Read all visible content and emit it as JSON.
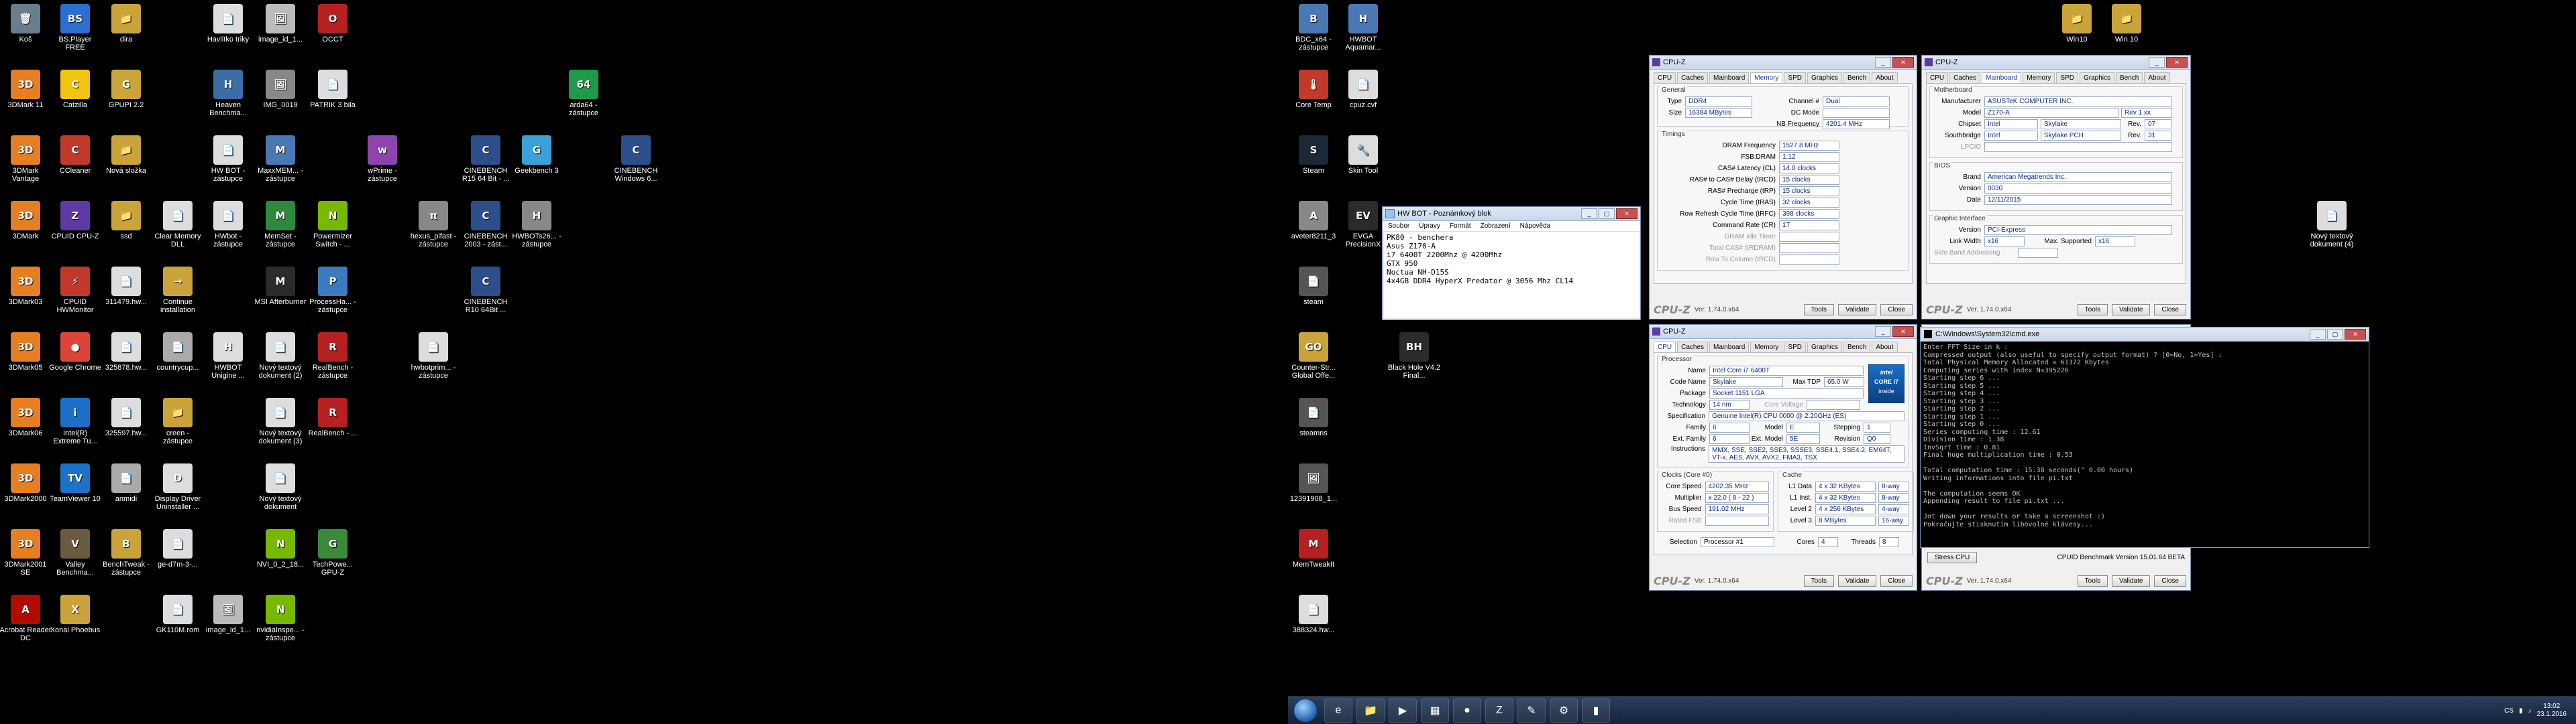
{
  "left_desktop_icons": [
    {
      "label": "Koš",
      "color": "#6a7d8c",
      "glyph": "🗑"
    },
    {
      "label": "BS.Player FREE",
      "color": "#2a6fd1",
      "glyph": "BS"
    },
    {
      "label": "dira",
      "color": "#caa43a",
      "glyph": "📁"
    },
    {
      "label": "Havlitko triky",
      "color": "#ddd",
      "glyph": "📄"
    },
    {
      "label": "image_id_1...",
      "color": "#bbb",
      "glyph": "🖼"
    },
    {
      "label": "OCCT",
      "color": "#b52020",
      "glyph": "O"
    },
    {
      "label": "3DMark 11",
      "color": "#e67e22",
      "glyph": "3D"
    },
    {
      "label": "Catzilla",
      "color": "#f1c40f",
      "glyph": "C"
    },
    {
      "label": "GPUPI 2.2",
      "color": "#c9a53a",
      "glyph": "G"
    },
    {
      "label": "Heaven Benchma...",
      "color": "#3a6ea5",
      "glyph": "H"
    },
    {
      "label": "IMG_0019",
      "color": "#888",
      "glyph": "🖼"
    },
    {
      "label": "PATRIK 3 bila",
      "color": "#ddd",
      "glyph": "📄"
    },
    {
      "label": "arda64 - zástupce",
      "color": "#1e9a4a",
      "glyph": "64"
    },
    {
      "label": "3DMark Vantage",
      "color": "#e67e22",
      "glyph": "3D"
    },
    {
      "label": "CCleaner",
      "color": "#c0392b",
      "glyph": "C"
    },
    {
      "label": "Nová složka",
      "color": "#caa43a",
      "glyph": "📁"
    },
    {
      "label": "HW BOT - zástupce",
      "color": "#ddd",
      "glyph": "📄"
    },
    {
      "label": "MaxxMEM... - zástupce",
      "color": "#4a78b5",
      "glyph": "M"
    },
    {
      "label": "wPrime - zástupce",
      "color": "#8e44ad",
      "glyph": "w"
    },
    {
      "label": "CINEBENCH R15 64 Bit - ...",
      "color": "#2c4f8c",
      "glyph": "C"
    },
    {
      "label": "Geekbench 3",
      "color": "#3aa0d8",
      "glyph": "G"
    },
    {
      "label": "CINEBENCH Windows 6...",
      "color": "#2c4f8c",
      "glyph": "C"
    },
    {
      "label": "3DMark",
      "color": "#e67e22",
      "glyph": "3D"
    },
    {
      "label": "CPUID CPU-Z",
      "color": "#5e3aa5",
      "glyph": "Z"
    },
    {
      "label": "ssd",
      "color": "#caa43a",
      "glyph": "📁"
    },
    {
      "label": "Clear Memory DLL",
      "color": "#ddd",
      "glyph": "📄"
    },
    {
      "label": "HWbot - zástupce",
      "color": "#ddd",
      "glyph": "📄"
    },
    {
      "label": "MemSet - zástupce",
      "color": "#2d8a3d",
      "glyph": "M"
    },
    {
      "label": "Powermizer Switch - ...",
      "color": "#76b900",
      "glyph": "N"
    },
    {
      "label": "hexus_pifast - zástupce",
      "color": "#888",
      "glyph": "π"
    },
    {
      "label": "CINEBENCH 2003 - zást...",
      "color": "#2c4f8c",
      "glyph": "C"
    },
    {
      "label": "HWBOTs26... - zástupce",
      "color": "#888",
      "glyph": "H"
    },
    {
      "label": "3DMark03",
      "color": "#e67e22",
      "glyph": "3D"
    },
    {
      "label": "CPUID HWMonitor",
      "color": "#c0392b",
      "glyph": "⚡"
    },
    {
      "label": "311479.hw...",
      "color": "#ddd",
      "glyph": "📄"
    },
    {
      "label": "Continue installation",
      "color": "#caa43a",
      "glyph": "→"
    },
    {
      "label": "MSI Afterburner",
      "color": "#2b2b2b",
      "glyph": "M"
    },
    {
      "label": "ProcessHa... - zástupce",
      "color": "#3b7bbf",
      "glyph": "P"
    },
    {
      "label": "CINEBENCH R10 64Bit ...",
      "color": "#2c4f8c",
      "glyph": "C"
    },
    {
      "label": "3DMark05",
      "color": "#e67e22",
      "glyph": "3D"
    },
    {
      "label": "Google Chrome",
      "color": "#db4437",
      "glyph": "●"
    },
    {
      "label": "325878.hw...",
      "color": "#ddd",
      "glyph": "📄"
    },
    {
      "label": "countrycup...",
      "color": "#aaa",
      "glyph": "📄"
    },
    {
      "label": "HWBOT Unigine ...",
      "color": "#ddd",
      "glyph": "H"
    },
    {
      "label": "Nový textový dokument (2)",
      "color": "#ddd",
      "glyph": "📄"
    },
    {
      "label": "RealBench - zástupce",
      "color": "#b52020",
      "glyph": "R"
    },
    {
      "label": "hwbotprim... - zástupce",
      "color": "#ddd",
      "glyph": "📄"
    },
    {
      "label": "3DMark06",
      "color": "#e67e22",
      "glyph": "3D"
    },
    {
      "label": "Intel(R) Extreme Tu...",
      "color": "#1c6fc4",
      "glyph": "i"
    },
    {
      "label": "325597.hw...",
      "color": "#ddd",
      "glyph": "📄"
    },
    {
      "label": "creen - zástupce",
      "color": "#caa43a",
      "glyph": "📁"
    },
    {
      "label": "Nový textový dokument (3)",
      "color": "#ddd",
      "glyph": "📄"
    },
    {
      "label": "RealBench - ...",
      "color": "#b52020",
      "glyph": "R"
    },
    {
      "label": "3DMark2000",
      "color": "#e67e22",
      "glyph": "3D"
    },
    {
      "label": "TeamViewer 10",
      "color": "#1a73c9",
      "glyph": "TV"
    },
    {
      "label": "anmidi",
      "color": "#aaa",
      "glyph": "📄"
    },
    {
      "label": "Display Driver Uninstaller ...",
      "color": "#ddd",
      "glyph": "D"
    },
    {
      "label": "Nový textový dokument",
      "color": "#ddd",
      "glyph": "📄"
    },
    {
      "label": "3DMark2001 SE",
      "color": "#e67e22",
      "glyph": "3D"
    },
    {
      "label": "Valley Benchma...",
      "color": "#6b5b3e",
      "glyph": "V"
    },
    {
      "label": "BenchTweak - zástupce",
      "color": "#caa43a",
      "glyph": "B"
    },
    {
      "label": "ge-d7m-3-...",
      "color": "#ddd",
      "glyph": "📄"
    },
    {
      "label": "NVI_0_2_18...",
      "color": "#76b900",
      "glyph": "N"
    },
    {
      "label": "TechPowe... GPU-Z",
      "color": "#3a8a3a",
      "glyph": "G"
    },
    {
      "label": "Acrobat Reader DC",
      "color": "#b30b00",
      "glyph": "A"
    },
    {
      "label": "Xonai Phoebus",
      "color": "#caa43a",
      "glyph": "X"
    },
    {
      "label": "GK110M.rom",
      "color": "#ddd",
      "glyph": "📄"
    },
    {
      "label": "image_id_1...",
      "color": "#bbb",
      "glyph": "🖼"
    },
    {
      "label": "nvidiaInspe... - zástupce",
      "color": "#76b900",
      "glyph": "N"
    }
  ],
  "right_desktop_icons": [
    {
      "label": "BDC_x64 - zástupce",
      "color": "#4a78b5",
      "glyph": "B"
    },
    {
      "label": "HWBOT Aquamar...",
      "color": "#4a78b5",
      "glyph": "H"
    },
    {
      "label": "Core Temp",
      "color": "#c0392b",
      "glyph": "🌡"
    },
    {
      "label": "cpuz.cvf",
      "color": "#ddd",
      "glyph": "📄"
    },
    {
      "label": "Steam",
      "color": "#1b2838",
      "glyph": "S"
    },
    {
      "label": "Skin Tool",
      "color": "#ddd",
      "glyph": "🔧"
    },
    {
      "label": "aveter8211_3",
      "color": "#888",
      "glyph": "A"
    },
    {
      "label": "EVGA PrecisionX",
      "color": "#2b2b2b",
      "glyph": "EV"
    },
    {
      "label": "steam",
      "color": "#555",
      "glyph": "📄"
    },
    {
      "label": "Counter-Str... Global Offe...",
      "color": "#caa43a",
      "glyph": "GO"
    },
    {
      "label": "Black Hole V4.2 Final...",
      "color": "#2b2b2b",
      "glyph": "BH"
    },
    {
      "label": "steamns",
      "color": "#555",
      "glyph": "📄"
    },
    {
      "label": "12391908_1...",
      "color": "#555",
      "glyph": "🖼"
    },
    {
      "label": "MemTweakIt",
      "color": "#b52020",
      "glyph": "M"
    },
    {
      "label": "388324.hw...",
      "color": "#ddd",
      "glyph": "📄"
    },
    {
      "label": "Win10",
      "color": "#caa43a",
      "glyph": "📁"
    },
    {
      "label": "Win 10",
      "color": "#caa43a",
      "glyph": "📁"
    },
    {
      "label": "Nový textový dokument (4)",
      "color": "#ddd",
      "glyph": "📄"
    }
  ],
  "notepad": {
    "title": "HW BOT - Poznámkový blok",
    "menu": [
      "Soubor",
      "Úpravy",
      "Formát",
      "Zobrazení",
      "Nápověda"
    ],
    "text": "PK80 - benchera\nAsus Z170-A\ni7 6400T 2200Mhz @ 4200Mhz\nGTX 950\nNoctua NH-D15S\n4x4GB DDR4 HyperX Predator @ 3056 Mhz CL14"
  },
  "cpuz_memory": {
    "title": "CPU-Z",
    "tabs": [
      "CPU",
      "Caches",
      "Mainboard",
      "Memory",
      "SPD",
      "Graphics",
      "Bench",
      "About"
    ],
    "active_tab": "Memory",
    "general_title": "General",
    "type_label": "Type",
    "type_value": "DDR4",
    "size_label": "Size",
    "size_value": "16384 MBytes",
    "channel_label": "Channel #",
    "channel_value": "Dual",
    "dcmode_label": "DC Mode",
    "dcmode_value": "",
    "nbfreq_label": "NB Frequency",
    "nbfreq_value": "4201.4 MHz",
    "timings_title": "Timings",
    "timings": [
      {
        "k": "DRAM Frequency",
        "v": "1527.8 MHz",
        "dim": false
      },
      {
        "k": "FSB:DRAM",
        "v": "1:12",
        "dim": false
      },
      {
        "k": "CAS# Latency (CL)",
        "v": "14.0 clocks",
        "dim": false
      },
      {
        "k": "RAS# to CAS# Delay (tRCD)",
        "v": "15 clocks",
        "dim": false
      },
      {
        "k": "RAS# Precharge (tRP)",
        "v": "15 clocks",
        "dim": false
      },
      {
        "k": "Cycle Time (tRAS)",
        "v": "32 clocks",
        "dim": false
      },
      {
        "k": "Row Refresh Cycle Time (tRFC)",
        "v": "398 clocks",
        "dim": false
      },
      {
        "k": "Command Rate (CR)",
        "v": "1T",
        "dim": false
      },
      {
        "k": "DRAM Idle Timer",
        "v": "",
        "dim": true
      },
      {
        "k": "Total CAS# (tRDRAM)",
        "v": "",
        "dim": true
      },
      {
        "k": "Row To Column (tRCD)",
        "v": "",
        "dim": true
      }
    ],
    "version": "Ver. 1.74.0.x64",
    "tools_label": "Tools",
    "validate_label": "Validate",
    "close_label": "Close"
  },
  "cpuz_mainboard": {
    "title": "CPU-Z",
    "tabs": [
      "CPU",
      "Caches",
      "Mainboard",
      "Memory",
      "SPD",
      "Graphics",
      "Bench",
      "About"
    ],
    "active_tab": "Mainboard",
    "mb_title": "Motherboard",
    "manufacturer_label": "Manufacturer",
    "manufacturer_value": "ASUSTeK COMPUTER INC.",
    "model_label": "Model",
    "model_value": "Z170-A",
    "model_rev": "Rev 1.xx",
    "chipset_label": "Chipset",
    "chipset_vendor": "Intel",
    "chipset_name": "Skylake",
    "chipset_rev_label": "Rev.",
    "chipset_rev": "07",
    "southbridge_label": "Southbridge",
    "sb_vendor": "Intel",
    "sb_name": "Skylake PCH",
    "sb_rev_label": "Rev.",
    "sb_rev": "31",
    "lpcio_label": "LPCIO",
    "lpcio_value": "",
    "bios_title": "BIOS",
    "brand_label": "Brand",
    "brand_value": "American Megatrends Inc.",
    "bversion_label": "Version",
    "bversion_value": "0030",
    "date_label": "Date",
    "date_value": "12/11/2015",
    "gi_title": "Graphic Interface",
    "gi_version_label": "Version",
    "gi_version_value": "PCI-Express",
    "gi_link_label": "Link Width",
    "gi_link_value": "x16",
    "gi_max_label": "Max. Supported",
    "gi_max_value": "x16",
    "gi_sideband_label": "Side Band Addressing",
    "gi_sideband_value": "",
    "version": "Ver. 1.74.0.x64",
    "tools_label": "Tools",
    "validate_label": "Validate",
    "close_label": "Close"
  },
  "cpuz_cpu": {
    "title": "CPU-Z",
    "tabs": [
      "CPU",
      "Caches",
      "Mainboard",
      "Memory",
      "SPD",
      "Graphics",
      "Bench",
      "About"
    ],
    "active_tab": "CPU",
    "proc_title": "Processor",
    "name_label": "Name",
    "name_value": "Intel Core i7 6400T",
    "codename_label": "Code Name",
    "codename_value": "Skylake",
    "maxtdp_label": "Max TDP",
    "maxtdp_value": "65.0 W",
    "package_label": "Package",
    "package_value": "Socket 1151 LGA",
    "tech_label": "Technology",
    "tech_value": "14 nm",
    "corevolt_label": "Core Voltage",
    "corevolt_value": "",
    "spec_label": "Specification",
    "spec_value": "Genuine Intel(R) CPU 0000 @ 2.20GHz (ES)",
    "family_label": "Family",
    "family_value": "6",
    "model_label": "Model",
    "model_value": "E",
    "stepping_label": "Stepping",
    "stepping_value": "1",
    "extfamily_label": "Ext. Family",
    "extfamily_value": "6",
    "extmodel_label": "Ext. Model",
    "extmodel_value": "5E",
    "revision_label": "Revision",
    "revision_value": "Q0",
    "instr_label": "Instructions",
    "instr_value": "MMX, SSE, SSE2, SSE3, SSSE3, SSE4.1, SSE4.2, EM64T, VT-x, AES, AVX, AVX2, FMA3, TSX",
    "clocks_title": "Clocks (Core #0)",
    "corespeed_label": "Core Speed",
    "corespeed_value": "4202.35 MHz",
    "multiplier_label": "Multiplier",
    "multiplier_value": "x 22.0 ( 8 - 22 )",
    "busspeed_label": "Bus Speed",
    "busspeed_value": "191.02 MHz",
    "ratedfsb_label": "Rated FSB",
    "ratedfsb_value": "",
    "cache_title": "Cache",
    "caches": [
      {
        "k": "L1 Data",
        "v": "4 x 32 KBytes",
        "w": "8-way"
      },
      {
        "k": "L1 Inst.",
        "v": "4 x 32 KBytes",
        "w": "8-way"
      },
      {
        "k": "Level 2",
        "v": "4 x 256 KBytes",
        "w": "4-way"
      },
      {
        "k": "Level 3",
        "v": "8 MBytes",
        "w": "16-way"
      }
    ],
    "selection_label": "Selection",
    "selection_value": "Processor #1",
    "cores_label": "Cores",
    "cores_value": "4",
    "threads_label": "Threads",
    "threads_value": "8",
    "badge_line1": "intel",
    "badge_line2": "CORE i7",
    "badge_line3": "inside",
    "version": "Ver. 1.74.0.x64",
    "tools_label": "Tools",
    "validate_label": "Validate",
    "close_label": "Close"
  },
  "cmd": {
    "title": "C:\\Windows\\System32\\cmd.exe",
    "text": "Enter FFT Size in k :\nCompressed output (also useful to specify output format) ? [0=No, 1=Yes] :\nTotal Physical Memory Allocated = 61372 Kbytes\nComputing series with index N=395226\nStarting step 6 ...\nStarting step 5 ...\nStarting step 4 ...\nStarting step 3 ...\nStarting step 2 ...\nStarting step 1 ...\nStarting step 0 ...\nSeries computing time : 12.61\nDivision time : 1.38\nInvSqrt time : 0.81\nFinal huge multiplication time : 0.53\n\nTotal computation time : 15.38 seconds(\" 0.00 hours)\nWriting informations into file pi.txt\n\nThe computation seems OK\nAppending result to file pi.txt ...\n\nJot down your results or take a screenshot :)\nPokračujte stisknutím libovolné klávesy..."
  },
  "cpuz_bench_strip": {
    "stress_label": "Stress CPU",
    "bench_version": "CPUID Benchmark Version 15.01.64 BETA",
    "version": "Ver. 1.74.0.x64",
    "tools_label": "Tools",
    "validate_label": "Validate",
    "close_label": "Close"
  },
  "taskbar": {
    "apps": [
      "ie-icon",
      "folder-icon",
      "media-icon",
      "gpu-icon",
      "chrome-icon",
      "cpuz-icon",
      "notepad-icon",
      "tools-icon",
      "cmd-icon"
    ],
    "tray_lang": "CS",
    "time": "13:02",
    "date": "23.1.2016"
  }
}
